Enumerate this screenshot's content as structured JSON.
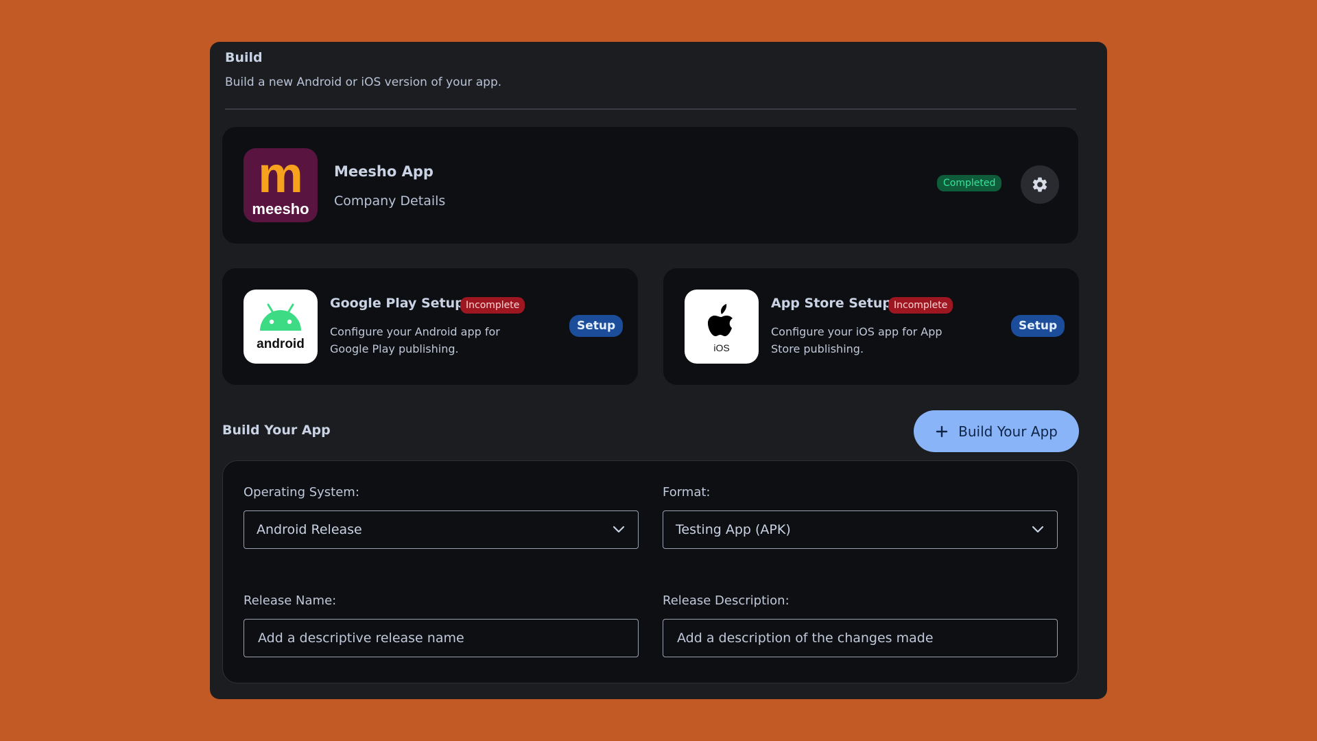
{
  "header": {
    "title": "Build",
    "subtitle": "Build a new Android or iOS version of your app."
  },
  "app_card": {
    "logo_text": "meesho",
    "logo_letter": "m",
    "name": "Meesho App",
    "subtitle": "Company Details",
    "status": "Completed",
    "settings_icon": "gear-icon"
  },
  "google_play": {
    "logo_text": "android",
    "title": "Google Play Setup",
    "status": "Incomplete",
    "description": "Configure your Android app for Google Play publishing.",
    "button_label": "Setup"
  },
  "app_store": {
    "logo_text": "iOS",
    "title": "App Store Setup",
    "status": "Incomplete",
    "description": "Configure your iOS app for App Store publishing.",
    "button_label": "Setup"
  },
  "build": {
    "section_title": "Build Your App",
    "button_label": "Build Your App",
    "os_label": "Operating System:",
    "os_value": "Android Release",
    "format_label": "Format:",
    "format_value": "Testing App (APK)",
    "release_name_label": "Release Name:",
    "release_name_placeholder": "Add a descriptive release name",
    "release_desc_label": "Release Description:",
    "release_desc_placeholder": "Add a description of the changes made"
  },
  "colors": {
    "background": "#c25a26",
    "panel": "#1c1d21",
    "card": "#0e0f13",
    "completed": "#35e49a",
    "incomplete": "#9e1620",
    "setup_button": "#1c4d9b",
    "primary_button": "#8ab4f8"
  }
}
